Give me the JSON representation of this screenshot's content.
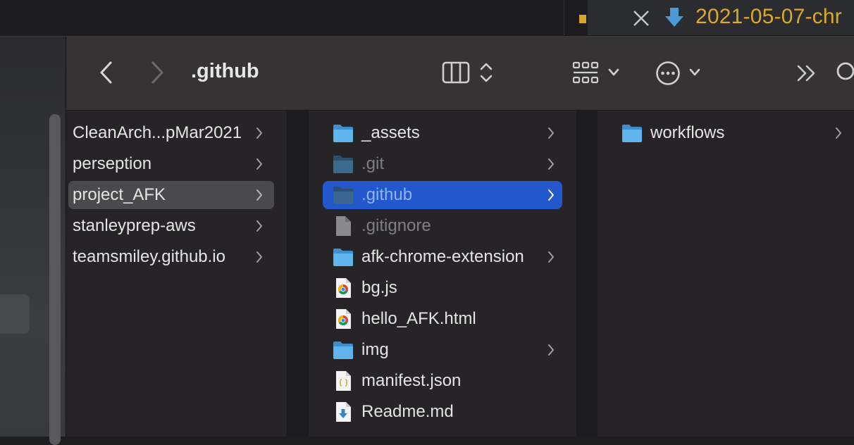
{
  "editor": {
    "active_tab_title": "2021-05-07-chr"
  },
  "finder": {
    "title": ".github",
    "columns": [
      {
        "items": [
          {
            "label": "CleanArch...pMar2021",
            "selected": false
          },
          {
            "label": "perseption",
            "selected": false
          },
          {
            "label": "project_AFK",
            "selected": true
          },
          {
            "label": "stanleyprep-aws",
            "selected": false
          },
          {
            "label": "teamsmiley.github.io",
            "selected": false
          }
        ]
      },
      {
        "items": [
          {
            "label": "_assets",
            "icon": "folder-icon",
            "has_children": true
          },
          {
            "label": ".git",
            "icon": "folder-icon",
            "has_children": true,
            "dim": true
          },
          {
            "label": ".github",
            "icon": "folder-icon",
            "has_children": true,
            "selected": true
          },
          {
            "label": ".gitignore",
            "icon": "file-icon",
            "has_children": false,
            "dim": true
          },
          {
            "label": "afk-chrome-extension",
            "icon": "folder-icon",
            "has_children": true
          },
          {
            "label": "bg.js",
            "icon": "chrome-doc-icon",
            "has_children": false
          },
          {
            "label": "hello_AFK.html",
            "icon": "chrome-doc-icon",
            "has_children": false
          },
          {
            "label": "img",
            "icon": "folder-icon",
            "has_children": true
          },
          {
            "label": "manifest.json",
            "icon": "json-file-icon",
            "has_children": false
          },
          {
            "label": "Readme.md",
            "icon": "markdown-file-icon",
            "has_children": false
          }
        ]
      },
      {
        "items": [
          {
            "label": "workflows",
            "icon": "folder-icon",
            "has_children": true
          }
        ]
      }
    ]
  },
  "colors": {
    "selection_blue": "#2357cc",
    "folder_blue": "#5fb4ee",
    "tab_title_gold": "#d9a82d"
  }
}
